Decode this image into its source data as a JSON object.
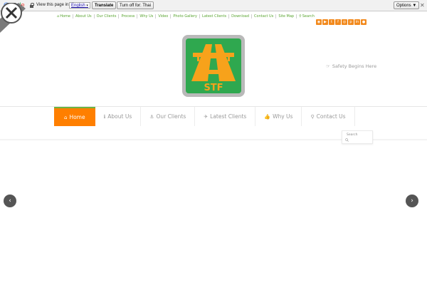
{
  "translate_bar": {
    "logo": [
      "G",
      "o",
      "o",
      "g",
      "l",
      "e"
    ],
    "view_text": "View this page in:",
    "language": "English",
    "translate_label": "Translate",
    "turnoff_label": "Turn off for: Thai",
    "options_label": "Options ▼",
    "close": "✕"
  },
  "top_nav": {
    "items": [
      {
        "icon": "⌂",
        "label": "Home"
      },
      {
        "icon": "",
        "label": "About Us"
      },
      {
        "icon": "",
        "label": "Our Clients"
      },
      {
        "icon": "",
        "label": "Process"
      },
      {
        "icon": "",
        "label": "Why Us"
      },
      {
        "icon": "",
        "label": "Video"
      },
      {
        "icon": "",
        "label": "Photo Gallery"
      },
      {
        "icon": "",
        "label": "Latest Clients"
      },
      {
        "icon": "",
        "label": "Download"
      },
      {
        "icon": "",
        "label": "Contact Us"
      },
      {
        "icon": "",
        "label": "Site Map"
      },
      {
        "icon": "⚲",
        "label": "Search"
      }
    ]
  },
  "social": [
    "rss-icon",
    "youtube-icon",
    "twitter-icon",
    "facebook-icon",
    "instagram-icon",
    "pinterest-icon",
    "linkedin-icon",
    "flickr-icon"
  ],
  "logo": {
    "text": "STF",
    "bg_color": "#2fa84f",
    "accent_color": "#f7a21b"
  },
  "tagline": {
    "icon": "☞",
    "text": "Safety Begins Here"
  },
  "main_nav": {
    "items": [
      {
        "icon": "⌂",
        "label": "Home",
        "active": true
      },
      {
        "icon": "ℹ",
        "label": "About Us",
        "active": false
      },
      {
        "icon": "⚓",
        "label": "Our Clients",
        "active": false
      },
      {
        "icon": "✈",
        "label": "Latest Clients",
        "active": false
      },
      {
        "icon": "👍",
        "label": "Why Us",
        "active": false
      },
      {
        "icon": "⚲",
        "label": "Contact Us",
        "active": false
      }
    ]
  },
  "search": {
    "label": "Search"
  },
  "slider": {
    "prev": "‹",
    "next": "›"
  },
  "colors": {
    "accent": "#ff7f00",
    "green": "#6db33f"
  }
}
